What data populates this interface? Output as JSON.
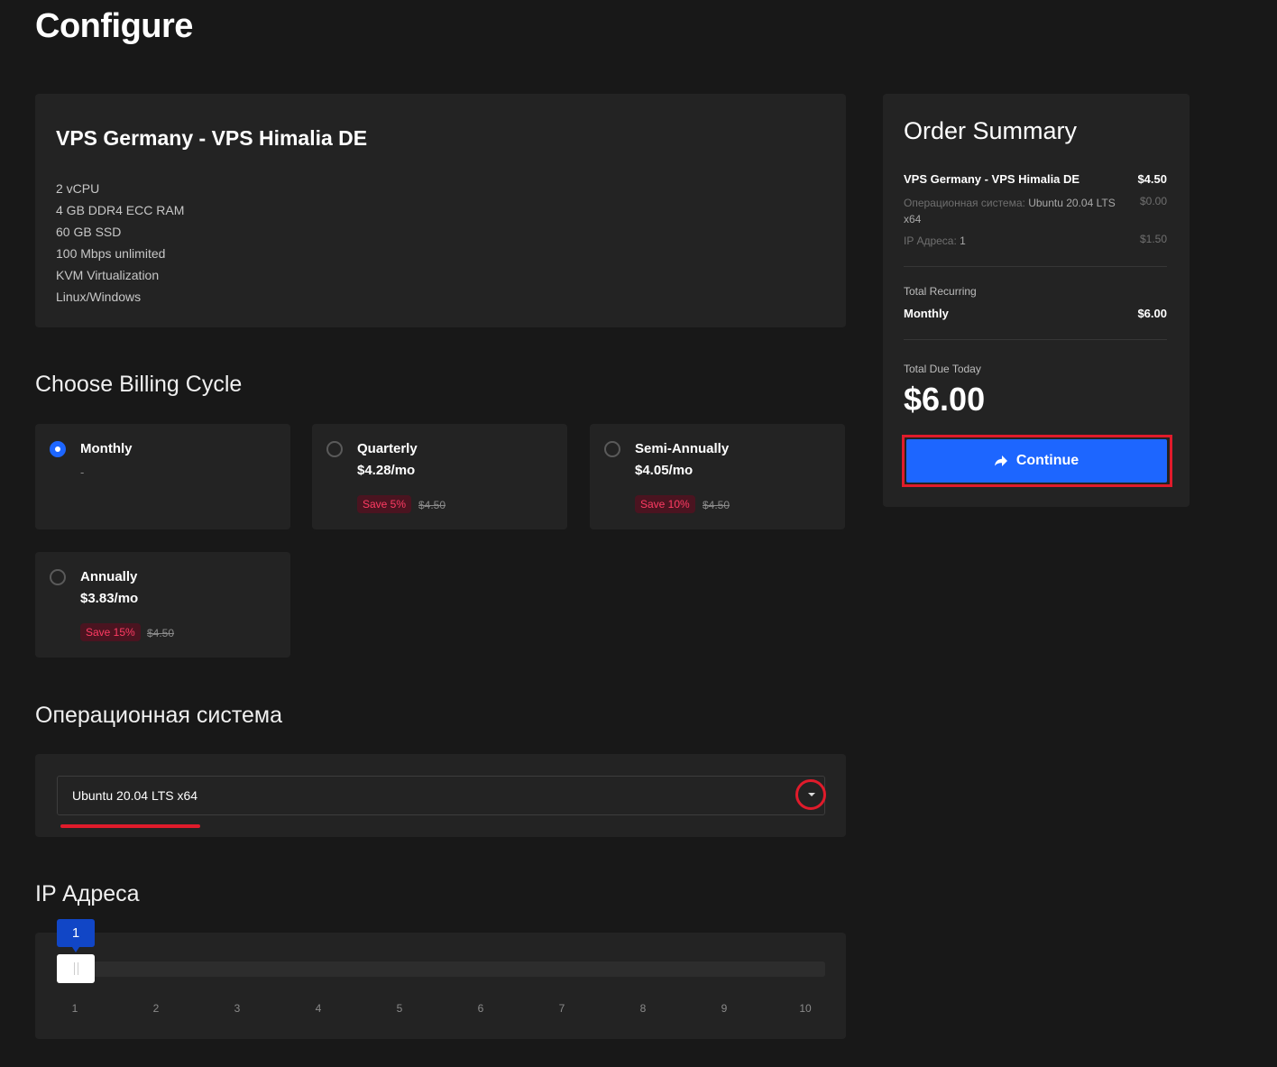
{
  "page": {
    "title": "Configure"
  },
  "product": {
    "name": "VPS Germany - VPS Himalia DE",
    "features": [
      "2 vCPU",
      "4 GB DDR4 ECC RAM",
      "60 GB SSD",
      "100 Mbps unlimited",
      "KVM Virtualization",
      "Linux/Windows"
    ]
  },
  "billing": {
    "title": "Choose Billing Cycle",
    "selected": "Monthly",
    "options": [
      {
        "name": "Monthly",
        "price": "",
        "detail": "-",
        "save": "",
        "old_price": ""
      },
      {
        "name": "Quarterly",
        "price": "$4.28/mo",
        "detail": "",
        "save": "Save 5%",
        "old_price": "$4.50"
      },
      {
        "name": "Semi-Annually",
        "price": "$4.05/mo",
        "detail": "",
        "save": "Save 10%",
        "old_price": "$4.50"
      },
      {
        "name": "Annually",
        "price": "$3.83/mo",
        "detail": "",
        "save": "Save 15%",
        "old_price": "$4.50"
      }
    ]
  },
  "os": {
    "title": "Операционная система",
    "value": "Ubuntu 20.04 LTS x64"
  },
  "ip": {
    "title": "IP Адреса",
    "value": "1",
    "ticks": [
      "1",
      "2",
      "3",
      "4",
      "5",
      "6",
      "7",
      "8",
      "9",
      "10"
    ]
  },
  "summary": {
    "title": "Order Summary",
    "product_name": "VPS Germany - VPS Himalia DE",
    "product_price": "$4.50",
    "os_label": "Операционная система:",
    "os_value": "Ubuntu 20.04 LTS x64",
    "os_price": "$0.00",
    "ip_label": "IP Адреса:",
    "ip_value": "1",
    "ip_price": "$1.50",
    "recurring_caption": "Total Recurring",
    "recurring_cycle": "Monthly",
    "recurring_price": "$6.00",
    "due_caption": "Total Due Today",
    "due_total": "$6.00",
    "continue_label": "Continue"
  },
  "colors": {
    "accent": "#1d66ff",
    "highlight": "#e01b2b",
    "save_badge_text": "#ff3b63",
    "background": "#181818",
    "card": "#232323"
  },
  "icons": {
    "continue": "arrow-right-icon",
    "dropdown": "caret-down-icon"
  }
}
